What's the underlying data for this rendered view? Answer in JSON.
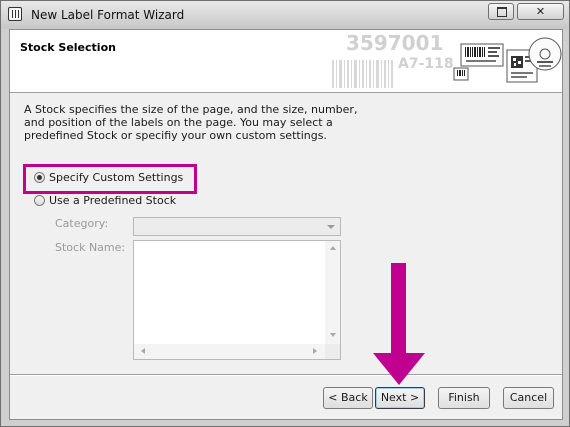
{
  "window": {
    "title": "New Label Format Wizard",
    "close_symbol": "✕",
    "accent_color": "#c0008f"
  },
  "header": {
    "title": "Stock Selection",
    "art_text": [
      "3597001",
      "A7-118"
    ]
  },
  "intro": {
    "text": "A Stock specifies the size of the page, and the size, number, and position of the labels on the page. You may select a predefined Stock or specifiy your own custom settings."
  },
  "options": {
    "custom_label": "Specify Custom Settings",
    "custom_selected": true,
    "predefined_label": "Use a Predefined Stock",
    "predefined_selected": false
  },
  "fields": {
    "category_label": "Category:",
    "category_value": "",
    "stock_name_label": "Stock Name:"
  },
  "buttons": {
    "back": "< Back",
    "next": "Next >",
    "finish": "Finish",
    "cancel": "Cancel"
  }
}
